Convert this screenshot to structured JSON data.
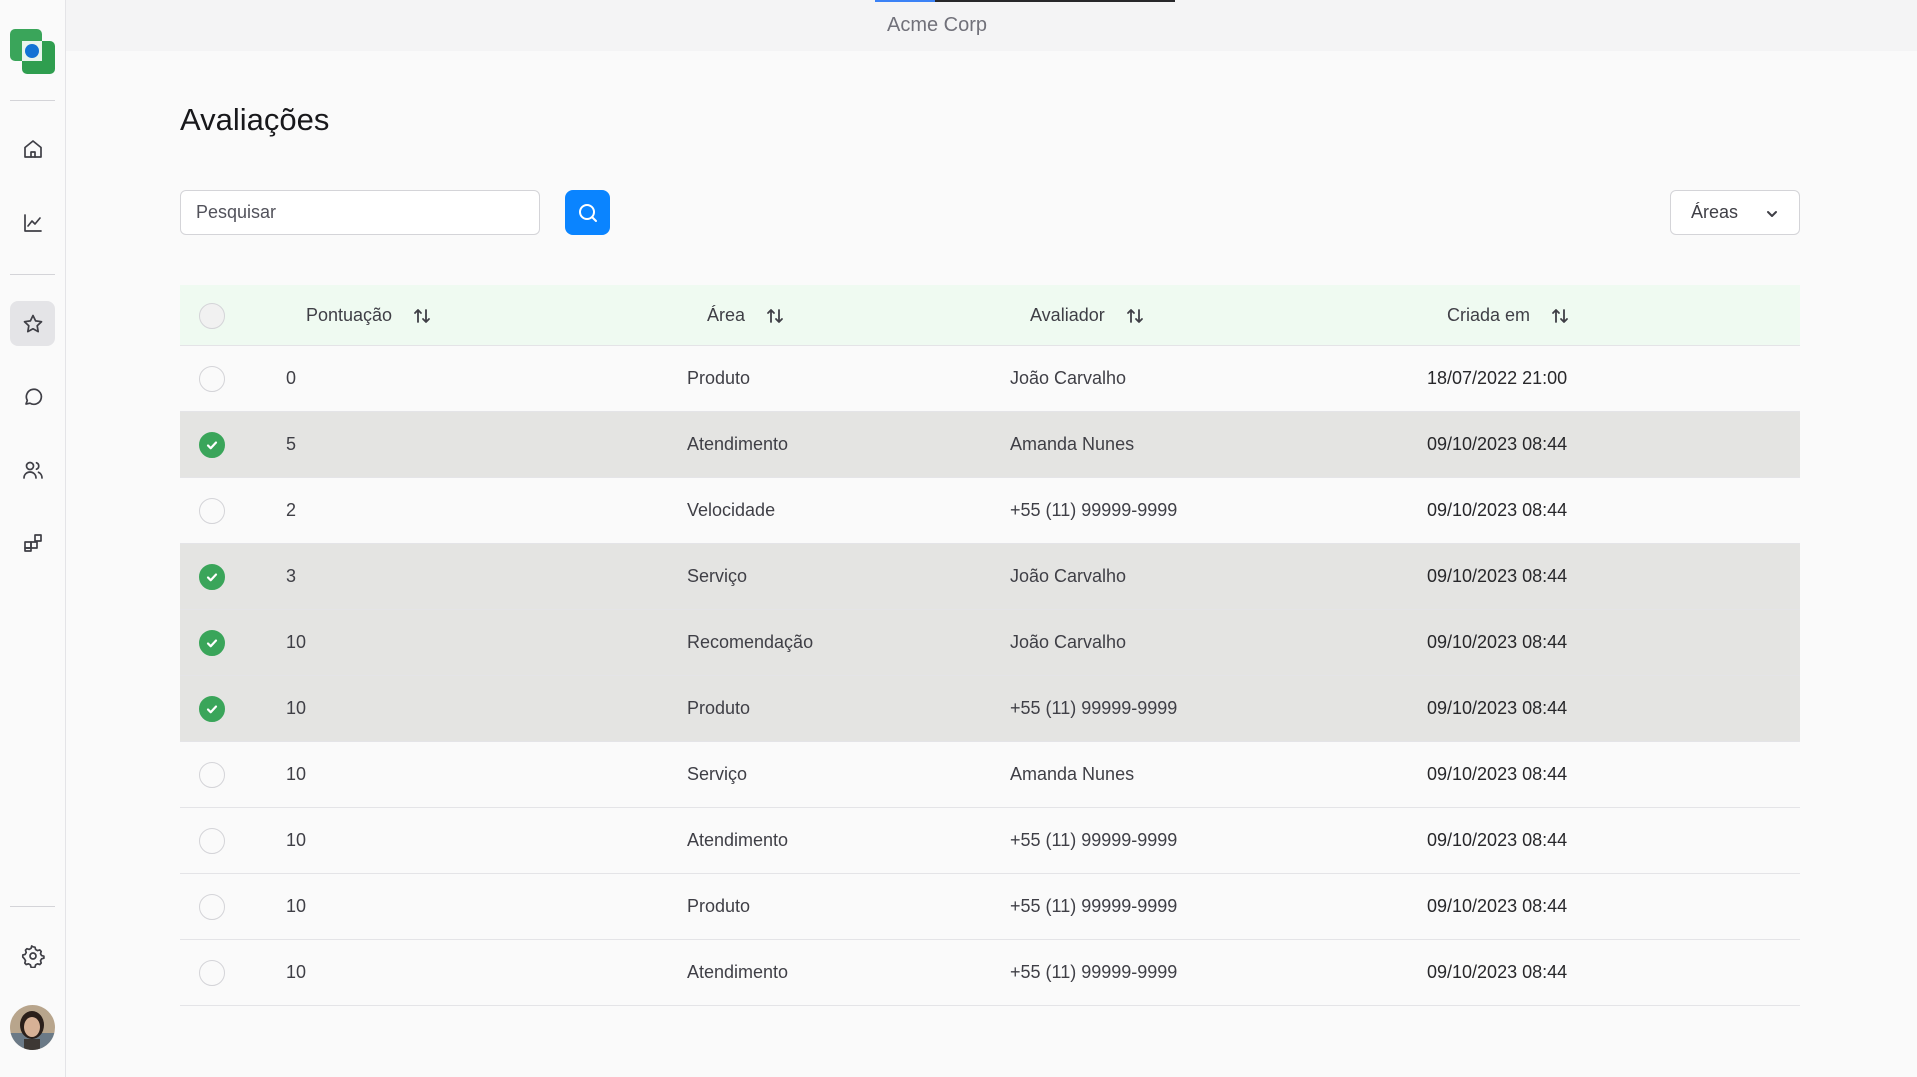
{
  "app": {
    "org_name": "Acme Corp"
  },
  "sidebar": {
    "items": [
      {
        "name": "home",
        "icon": "home-icon"
      },
      {
        "name": "reports",
        "icon": "chart-icon"
      },
      {
        "name": "ratings",
        "icon": "star-icon",
        "active": true
      },
      {
        "name": "messages",
        "icon": "chat-icon"
      },
      {
        "name": "users",
        "icon": "users-icon"
      },
      {
        "name": "integrations",
        "icon": "apps-icon"
      },
      {
        "name": "settings",
        "icon": "gear-icon"
      }
    ]
  },
  "page": {
    "title": "Avaliações"
  },
  "search": {
    "placeholder": "Pesquisar",
    "value": ""
  },
  "filter": {
    "areas_label": "Áreas"
  },
  "table": {
    "columns": [
      "Pontuação",
      "Área",
      "Avaliador",
      "Criada em"
    ],
    "rows": [
      {
        "selected": false,
        "score": "0",
        "area": "Produto",
        "evaluator": "João Carvalho",
        "created": "18/07/2022 21:00"
      },
      {
        "selected": true,
        "score": "5",
        "area": "Atendimento",
        "evaluator": "Amanda Nunes",
        "created": "09/10/2023 08:44"
      },
      {
        "selected": false,
        "score": "2",
        "area": "Velocidade",
        "evaluator": "+55 (11) 99999-9999",
        "created": "09/10/2023 08:44"
      },
      {
        "selected": true,
        "score": "3",
        "area": "Serviço",
        "evaluator": "João Carvalho",
        "created": "09/10/2023 08:44"
      },
      {
        "selected": true,
        "score": "10",
        "area": "Recomendação",
        "evaluator": "João Carvalho",
        "created": "09/10/2023 08:44"
      },
      {
        "selected": true,
        "score": "10",
        "area": "Produto",
        "evaluator": "+55 (11) 99999-9999",
        "created": "09/10/2023 08:44"
      },
      {
        "selected": false,
        "score": "10",
        "area": "Serviço",
        "evaluator": "Amanda Nunes",
        "created": "09/10/2023 08:44"
      },
      {
        "selected": false,
        "score": "10",
        "area": "Atendimento",
        "evaluator": "+55 (11) 99999-9999",
        "created": "09/10/2023 08:44"
      },
      {
        "selected": false,
        "score": "10",
        "area": "Produto",
        "evaluator": "+55 (11) 99999-9999",
        "created": "09/10/2023 08:44"
      },
      {
        "selected": false,
        "score": "10",
        "area": "Atendimento",
        "evaluator": "+55 (11) 99999-9999",
        "created": "09/10/2023 08:44"
      }
    ]
  },
  "colors": {
    "primary": "#0a84ff",
    "check": "#3aa55a",
    "header_bg": "#effaf1",
    "selected_row": "#e4e4e2"
  }
}
